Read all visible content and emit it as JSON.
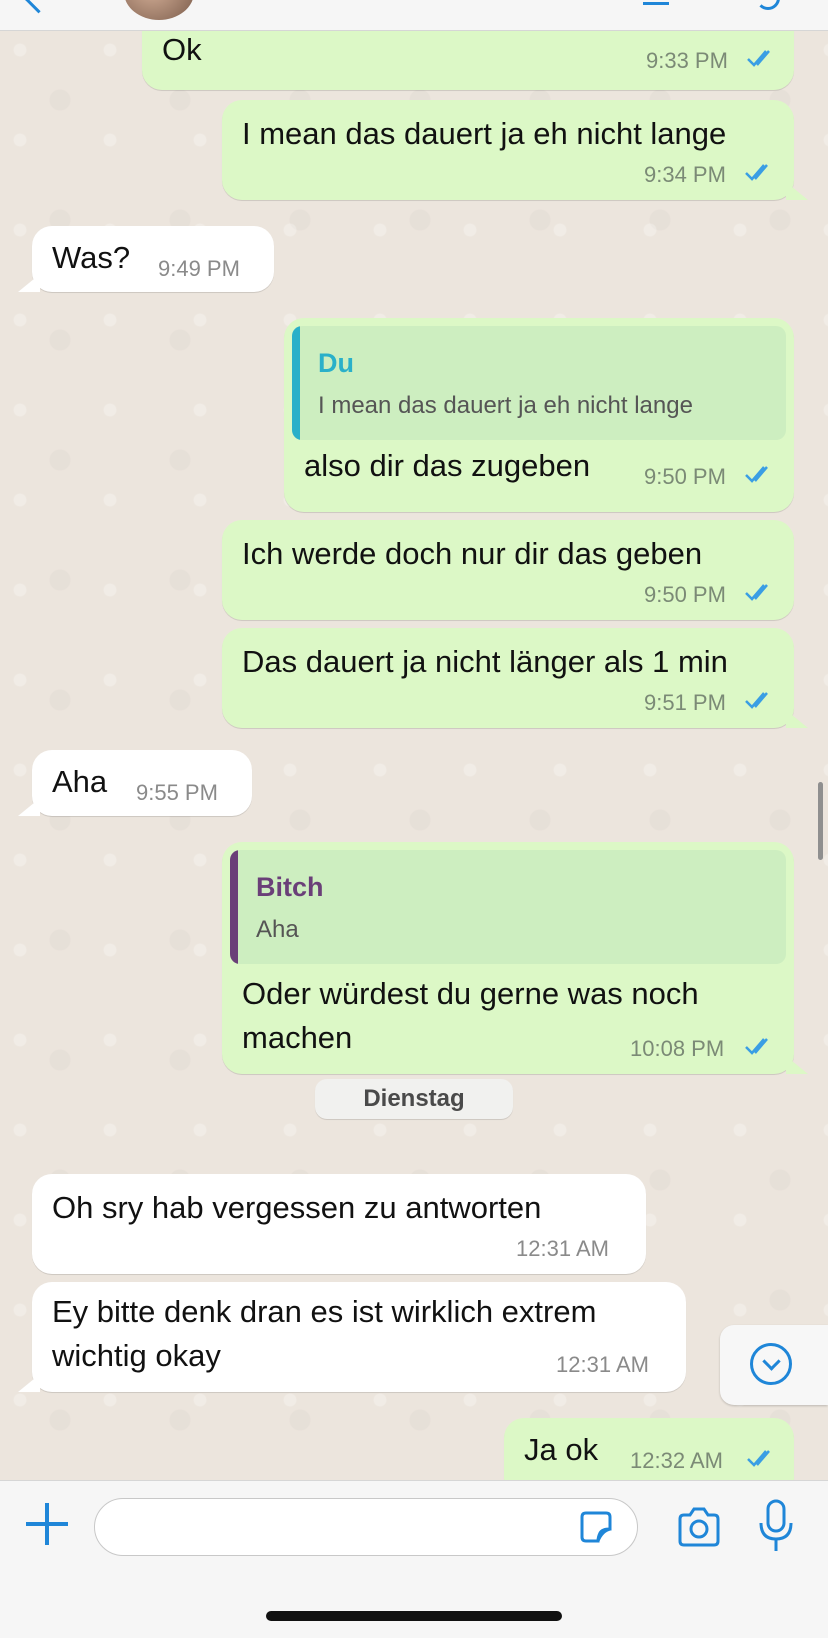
{
  "messages": [
    {
      "text": "Ok",
      "time": "9:33 PM"
    },
    {
      "text": "I mean das dauert ja eh nicht lange",
      "time": "9:34 PM"
    },
    {
      "text": "Was?",
      "time": "9:49 PM"
    },
    {
      "quote_name": "Du",
      "quote_text": "I mean das dauert ja eh nicht lange",
      "text": "also dir das zugeben",
      "time": "9:50 PM"
    },
    {
      "text": "Ich werde doch nur dir das geben",
      "time": "9:50 PM"
    },
    {
      "text": "Das dauert ja nicht länger als 1 min",
      "time": "9:51 PM"
    },
    {
      "text": "Aha",
      "time": "9:55 PM"
    },
    {
      "quote_name": "Bitch",
      "quote_text": "Aha",
      "text_line1": "Oder würdest du gerne was noch",
      "text_line2": "machen",
      "time": "10:08 PM"
    },
    {
      "text": "Oh sry hab vergessen zu antworten",
      "time": "12:31 AM"
    },
    {
      "text_line1": "Ey bitte denk dran es ist wirklich extrem",
      "text_line2": "wichtig okay",
      "time": "12:31 AM"
    },
    {
      "text": "Ja ok",
      "time": "12:32 AM"
    }
  ],
  "day_separator": "Dienstag",
  "colors": {
    "outgoing_bubble": "#dcf8c6",
    "incoming_bubble": "#ffffff",
    "accent": "#1f86d8",
    "quote_self": "#2ab0c9",
    "quote_other": "#6a3f78",
    "read_ticks": "#3a9ee4"
  },
  "icons": [
    "back-chevron-icon",
    "contact-avatar",
    "video-call-icon",
    "phone-icon",
    "plus-icon",
    "sticker-icon",
    "camera-icon",
    "microphone-icon",
    "scroll-down-icon"
  ]
}
